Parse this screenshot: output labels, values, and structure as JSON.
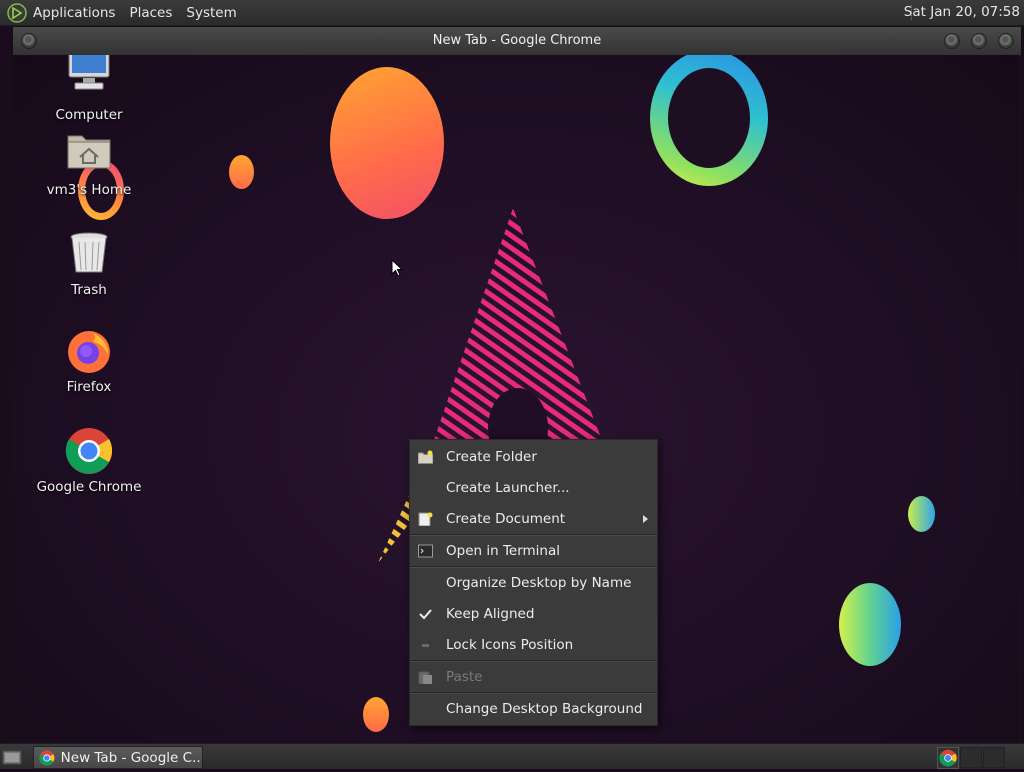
{
  "top_panel": {
    "menus": [
      "Applications",
      "Places",
      "System"
    ],
    "clock": "Sat Jan 20, 07:58"
  },
  "window": {
    "title": "New Tab - Google Chrome"
  },
  "desktop_icons": [
    {
      "label": "Computer",
      "icon": "computer-icon"
    },
    {
      "label": "vm3's Home",
      "icon": "home-folder-icon"
    },
    {
      "label": "Trash",
      "icon": "trash-icon"
    },
    {
      "label": "Firefox",
      "icon": "firefox-icon"
    },
    {
      "label": "Google Chrome",
      "icon": "chrome-icon"
    }
  ],
  "context_menu": {
    "items": [
      {
        "label": "Create Folder",
        "icon": "folder-new-icon",
        "enabled": true
      },
      {
        "label": "Create Launcher...",
        "enabled": true
      },
      {
        "label": "Create Document",
        "icon": "document-new-icon",
        "enabled": true,
        "submenu": true
      },
      {
        "label": "Open in Terminal",
        "icon": "terminal-icon",
        "enabled": true
      },
      {
        "label": "Organize Desktop by Name",
        "enabled": true
      },
      {
        "label": "Keep Aligned",
        "checked": true,
        "enabled": true
      },
      {
        "label": "Lock Icons Position",
        "checked": false,
        "enabled": true
      },
      {
        "label": "Paste",
        "icon": "paste-icon",
        "enabled": false
      },
      {
        "label": "Change Desktop Background",
        "enabled": true
      }
    ]
  },
  "taskbar": {
    "tasks": [
      {
        "label": "New Tab - Google C...",
        "icon": "chrome-icon"
      }
    ]
  }
}
